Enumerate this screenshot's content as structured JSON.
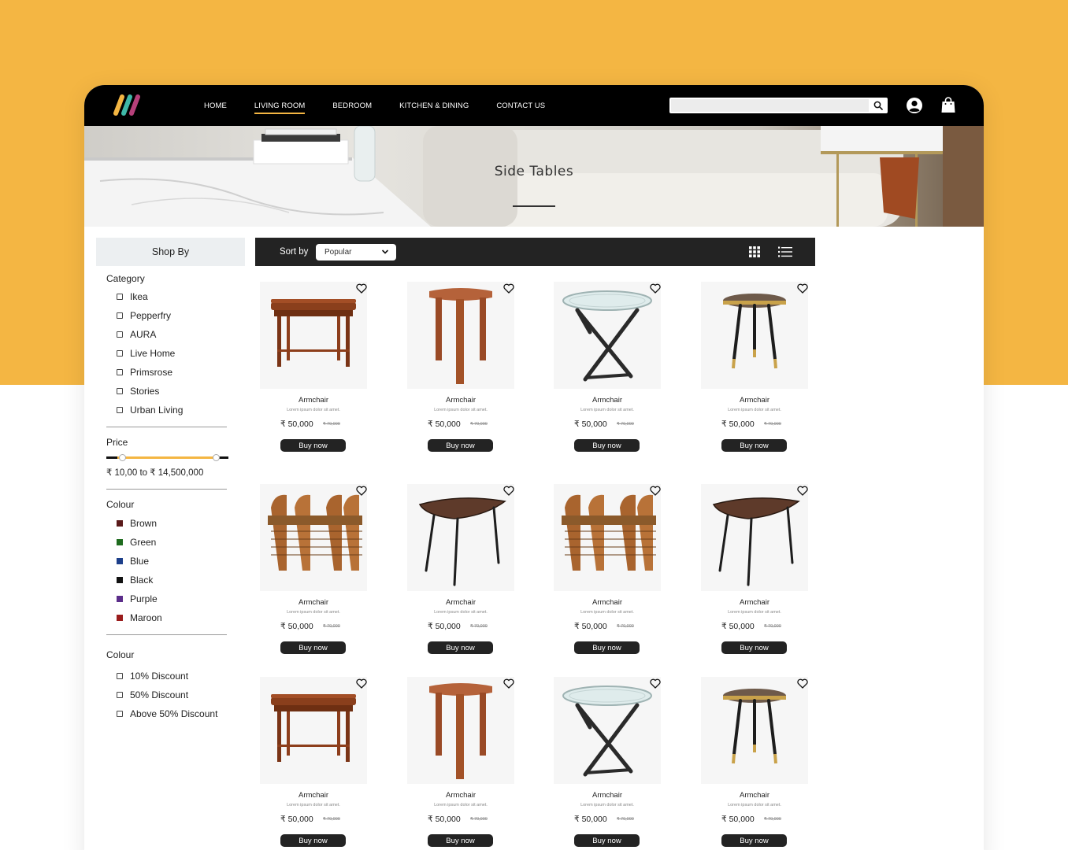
{
  "nav": {
    "items": [
      {
        "label": "HOME",
        "active": false
      },
      {
        "label": "LIVING ROOM",
        "active": true
      },
      {
        "label": "BEDROOM",
        "active": false
      },
      {
        "label": "KITCHEN & DINING",
        "active": false
      },
      {
        "label": "CONTACT US",
        "active": false
      }
    ],
    "search": {
      "value": "",
      "placeholder": ""
    }
  },
  "hero": {
    "title": "Side Tables"
  },
  "sidebar": {
    "shop_by": "Shop By",
    "category": {
      "heading": "Category",
      "items": [
        "Ikea",
        "Pepperfry",
        "AURA",
        "Live Home",
        "Primsrose",
        "Stories",
        "Urban Living"
      ]
    },
    "price": {
      "heading": "Price",
      "range_text": "₹ 10,00 to ₹ 14,500,000",
      "low_fraction": 0.13,
      "high_fraction": 0.9
    },
    "colour": {
      "heading": "Colour",
      "items": [
        {
          "label": "Brown",
          "color": "#5a1a1a"
        },
        {
          "label": "Green",
          "color": "#1e6b1e"
        },
        {
          "label": "Blue",
          "color": "#1c3f8a"
        },
        {
          "label": "Black",
          "color": "#111111"
        },
        {
          "label": "Purple",
          "color": "#5b2d8a"
        },
        {
          "label": "Maroon",
          "color": "#9a1c1c"
        }
      ]
    },
    "discount": {
      "heading": "Colour",
      "items": [
        "10% Discount",
        "50% Discount",
        "Above 50% Discount"
      ]
    }
  },
  "toolbar": {
    "sort_label": "Sort by",
    "sort_value": "Popular",
    "grid_icon": "grid-view-icon",
    "list_icon": "list-view-icon"
  },
  "products": [
    {
      "name": "Armchair",
      "desc": "Lorem ipsum dolor sit amet.",
      "price": "₹ 50,000",
      "old_price": "₹ 70,000",
      "button": "Buy now",
      "image": "wood-tray-table"
    },
    {
      "name": "Armchair",
      "desc": "Lorem ipsum dolor sit amet.",
      "price": "₹ 50,000",
      "old_price": "₹ 70,000",
      "button": "Buy now",
      "image": "wood-stool"
    },
    {
      "name": "Armchair",
      "desc": "Lorem ipsum dolor sit amet.",
      "price": "₹ 50,000",
      "old_price": "₹ 70,000",
      "button": "Buy now",
      "image": "glass-cross-table"
    },
    {
      "name": "Armchair",
      "desc": "Lorem ipsum dolor sit amet.",
      "price": "₹ 50,000",
      "old_price": "₹ 70,000",
      "button": "Buy now",
      "image": "round-tripod-table"
    },
    {
      "name": "Armchair",
      "desc": "Lorem ipsum dolor sit amet.",
      "price": "₹ 50,000",
      "old_price": "₹ 70,000",
      "button": "Buy now",
      "image": "rattan-bench"
    },
    {
      "name": "Armchair",
      "desc": "Lorem ipsum dolor sit amet.",
      "price": "₹ 50,000",
      "old_price": "₹ 70,000",
      "button": "Buy now",
      "image": "triangle-table"
    },
    {
      "name": "Armchair",
      "desc": "Lorem ipsum dolor sit amet.",
      "price": "₹ 50,000",
      "old_price": "₹ 70,000",
      "button": "Buy now",
      "image": "rattan-bench"
    },
    {
      "name": "Armchair",
      "desc": "Lorem ipsum dolor sit amet.",
      "price": "₹ 50,000",
      "old_price": "₹ 70,000",
      "button": "Buy now",
      "image": "triangle-table"
    },
    {
      "name": "Armchair",
      "desc": "Lorem ipsum dolor sit amet.",
      "price": "₹ 50,000",
      "old_price": "₹ 70,000",
      "button": "Buy now",
      "image": "wood-tray-table"
    },
    {
      "name": "Armchair",
      "desc": "Lorem ipsum dolor sit amet.",
      "price": "₹ 50,000",
      "old_price": "₹ 70,000",
      "button": "Buy now",
      "image": "wood-stool"
    },
    {
      "name": "Armchair",
      "desc": "Lorem ipsum dolor sit amet.",
      "price": "₹ 50,000",
      "old_price": "₹ 70,000",
      "button": "Buy now",
      "image": "glass-cross-table"
    },
    {
      "name": "Armchair",
      "desc": "Lorem ipsum dolor sit amet.",
      "price": "₹ 50,000",
      "old_price": "₹ 70,000",
      "button": "Buy now",
      "image": "round-tripod-table"
    }
  ]
}
